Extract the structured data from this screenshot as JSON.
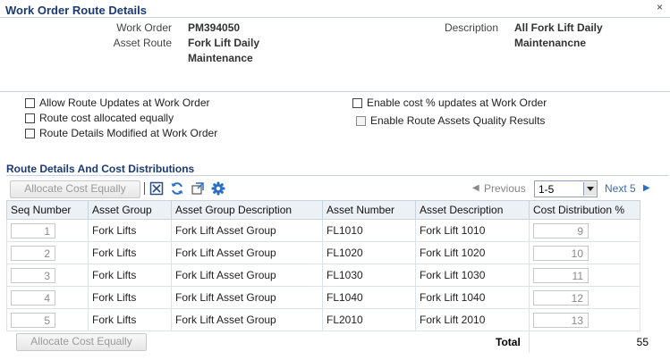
{
  "page": {
    "title": "Work Order Route Details",
    "close_glyph": "×"
  },
  "header": {
    "work_order_label": "Work Order",
    "work_order_value": "PM394050",
    "asset_route_label": "Asset Route",
    "asset_route_value_line1": "Fork Lift Daily",
    "asset_route_value_line2": "Maintenance",
    "description_label": "Description",
    "description_value_line1": "All Fork Lift Daily",
    "description_value_line2": "Maintenancne"
  },
  "options": {
    "allow_route_updates": "Allow Route Updates at Work Order",
    "route_cost_allocated": "Route cost allocated equally",
    "route_details_modified": "Route Details Modified at Work Order",
    "enable_cost_updates": "Enable cost % updates at Work Order",
    "enable_quality_results": "Enable Route Assets Quality Results"
  },
  "route_section": {
    "title": "Route Details And Cost Distributions",
    "allocate_button": "Allocate Cost Equally",
    "previous_label": "Previous",
    "range_value": "1-5",
    "next_label": "Next 5",
    "icons": [
      "columns-icon",
      "refresh-icon",
      "detach-icon",
      "settings-icon"
    ]
  },
  "table": {
    "headers": [
      "Seq Number",
      "Asset Group",
      "Asset Group Description",
      "Asset Number",
      "Asset Description",
      "Cost Distribution %"
    ],
    "rows": [
      {
        "seq": "1",
        "group": "Fork Lifts",
        "group_desc": "Fork Lift Asset Group",
        "number": "FL1010",
        "desc": "Fork Lift 1010",
        "cost": "9"
      },
      {
        "seq": "2",
        "group": "Fork Lifts",
        "group_desc": "Fork Lift Asset Group",
        "number": "FL1020",
        "desc": "Fork Lift 1020",
        "cost": "10"
      },
      {
        "seq": "3",
        "group": "Fork Lifts",
        "group_desc": "Fork Lift Asset Group",
        "number": "FL1030",
        "desc": "Fork Lift 1030",
        "cost": "11"
      },
      {
        "seq": "4",
        "group": "Fork Lifts",
        "group_desc": "Fork Lift Asset Group",
        "number": "FL1040",
        "desc": "Fork Lift 1040",
        "cost": "12"
      },
      {
        "seq": "5",
        "group": "Fork Lifts",
        "group_desc": "Fork Lift Asset Group",
        "number": "FL2010",
        "desc": "Fork Lift 2010",
        "cost": "13"
      }
    ]
  },
  "footer": {
    "allocate_button": "Allocate Cost Equally",
    "total_label": "Total",
    "total_value": "55"
  },
  "colors": {
    "title": "#1b3a73",
    "link": "#3b6cae",
    "icon_blue": "#2a6fc4"
  }
}
